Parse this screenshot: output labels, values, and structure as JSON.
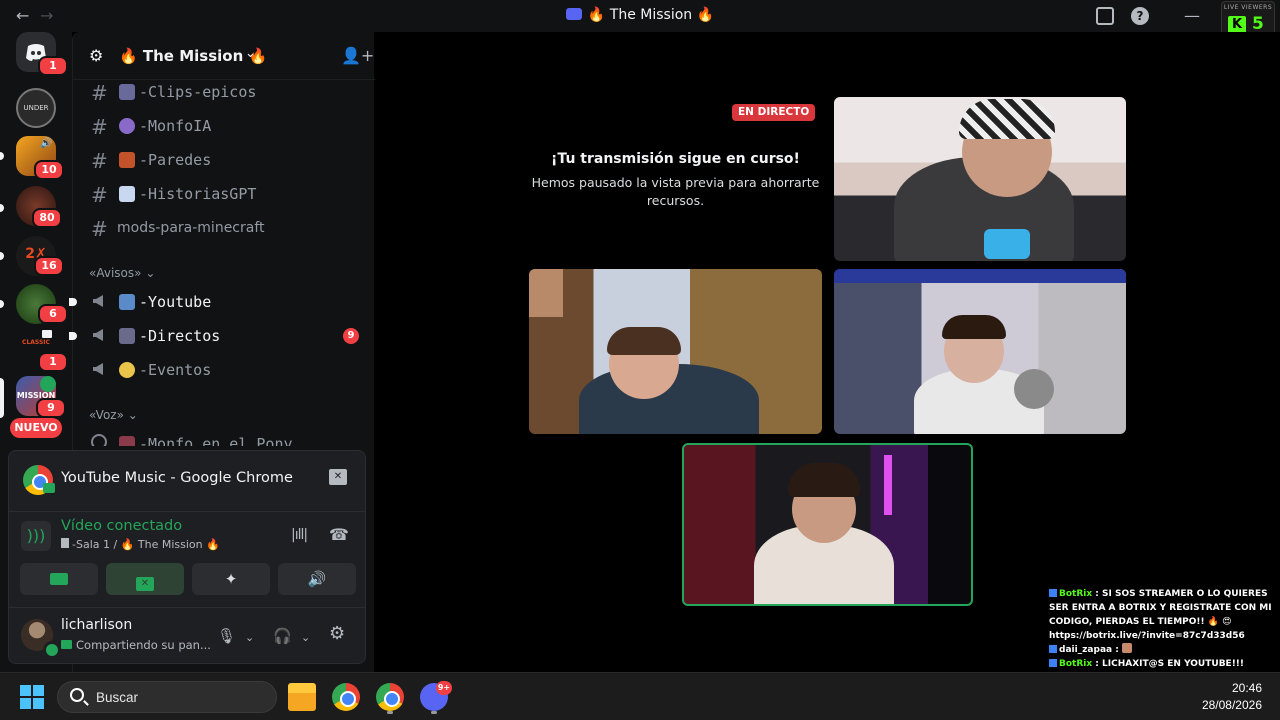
{
  "titlebar": {
    "title": "🔥 The Mission 🔥",
    "back_icon": "arrow-left-icon",
    "forward_icon": "arrow-right-icon"
  },
  "kick_widget": {
    "label": "LIVE VIEWERS",
    "count": "5"
  },
  "server_rail": {
    "badges": [
      "1",
      "10",
      "80",
      "16",
      "6",
      "1",
      "9"
    ],
    "new_label": "NUEVO"
  },
  "sidebar": {
    "server_name": "🔥 The Mission 🔥",
    "channels_top": [
      {
        "name": "-Clips-epicos"
      },
      {
        "name": "-MonfoIA"
      },
      {
        "name": "-Paredes"
      },
      {
        "name": "-HistoriasGPT"
      },
      {
        "name": "mods-para-minecraft"
      }
    ],
    "category_avisos": "«Avisos»",
    "channels_avisos": [
      {
        "name": "-Youtube"
      },
      {
        "name": "-Directos",
        "badge": "9"
      },
      {
        "name": "-Eventos"
      }
    ],
    "category_voz": "«Voz»",
    "voice_channel": "-Monfo en el Pony"
  },
  "share_panel": {
    "title": "YouTube Music - Google Chrome",
    "status": "Vídeo conectado",
    "room": "-Sala 1 / 🔥 The Mission 🔥"
  },
  "user_panel": {
    "username": "licharlison",
    "status": "Compartiendo su pan..."
  },
  "stage": {
    "live_badge": "EN DIRECTO",
    "paused_title": "¡Tu transmisión sigue en curso!",
    "paused_sub": "Hemos pausado la vista previa para ahorrarte recursos."
  },
  "chat": [
    {
      "user": "BotRix",
      "text": "SI SOS STREAMER O LO QUIERES SER ENTRA A BOTRIX Y REGISTRATE CON MI CODIGO, PIERDAS EL TIEMPO!! 🔥 😍https://botrix.live/?invite=87c7d33d56"
    },
    {
      "user": "daii_zapaa",
      "text": ""
    },
    {
      "user": "BotRix",
      "text": "LICHAXIT@S EN YOUTUBE!!! ESPERAMOS TU APOYO ❤ https://www.youtube.com/@TheLichax"
    }
  ],
  "taskbar": {
    "search_placeholder": "Buscar",
    "discord_badge": "9+",
    "time": "20:46",
    "date": "28/08/2026"
  },
  "colors": {
    "accent_green": "#23a55a",
    "badge_red": "#f23f43",
    "live_red": "#da373c",
    "kick_green": "#53fc18"
  }
}
